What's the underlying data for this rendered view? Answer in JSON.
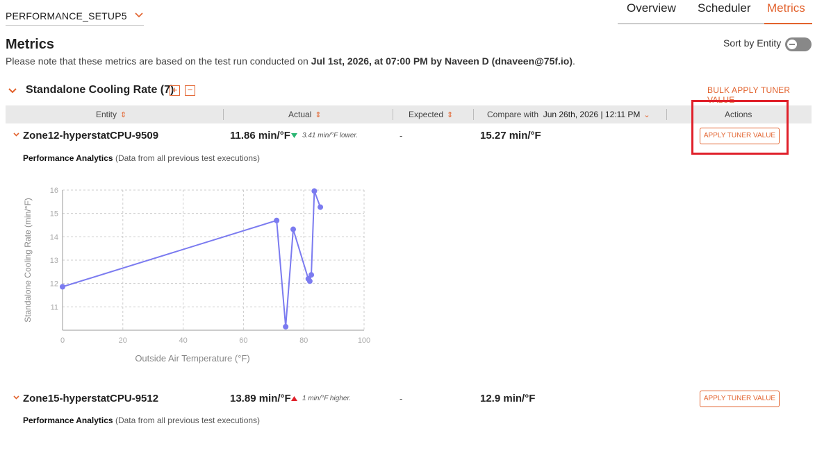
{
  "setup": {
    "name": "PERFORMANCE_SETUP5"
  },
  "tabs": [
    {
      "label": "Overview"
    },
    {
      "label": "Scheduler"
    },
    {
      "label": "Metrics"
    }
  ],
  "page": {
    "title": "Metrics",
    "note_prefix": "Please note that these metrics are based on the test run conducted on ",
    "note_date": "Jul 1st, 2026",
    "note_mid": ", at ",
    "note_time": "07:00 PM",
    "note_by": " by ",
    "note_user": "Naveen D (dnaveen@75f.io)",
    "note_suffix": "."
  },
  "sort": {
    "label": "Sort by Entity"
  },
  "group": {
    "title": "Standalone Cooling Rate (7)",
    "expand_label": "+",
    "collapse_label": "−",
    "bulk_label": "BULK APPLY TUNER VALUE"
  },
  "table": {
    "headers": {
      "entity": "Entity",
      "actual": "Actual",
      "expected": "Expected",
      "compare_prefix": "Compare with",
      "compare_date": "Jun 26th, 2026 | 12:11 PM",
      "actions": "Actions"
    },
    "rows": [
      {
        "entity": "Zone12-hyperstatCPU-9509",
        "actual": "11.86 min/°F",
        "delta": "3.41 min/°F lower.",
        "direction": "down",
        "expected": "-",
        "compare": "15.27 min/°F",
        "action": "APPLY TUNER VALUE"
      },
      {
        "entity": "Zone15-hyperstatCPU-9512",
        "actual": "13.89 min/°F",
        "delta": "1 min/°F higher.",
        "direction": "up",
        "expected": "-",
        "compare": "12.9 min/°F",
        "action": "APPLY TUNER VALUE"
      }
    ]
  },
  "analytics": {
    "title": "Performance Analytics",
    "note": "(Data from all previous test executions)"
  },
  "colors": {
    "accent": "#e2622d",
    "series": "#7b7bf0",
    "up": "#e0202a",
    "down": "#2bb673",
    "highlight": "#e0202a"
  },
  "chart_data": {
    "type": "line",
    "xlabel": "Outside Air Temperature (°F)",
    "ylabel": "Standalone Cooling Rate (min/°F)",
    "xlim": [
      0,
      100
    ],
    "ylim": [
      10,
      16
    ],
    "x_ticks": [
      0,
      20,
      40,
      60,
      80,
      100
    ],
    "y_ticks": [
      11,
      12,
      13,
      14,
      15,
      16
    ],
    "grid": true,
    "series": [
      {
        "x": [
          0,
          71,
          74,
          76.5,
          81.5,
          82,
          82.5,
          83.5,
          85.5
        ],
        "y": [
          11.86,
          14.7,
          10.15,
          14.32,
          12.2,
          12.1,
          12.37,
          15.96,
          15.27
        ]
      }
    ]
  }
}
